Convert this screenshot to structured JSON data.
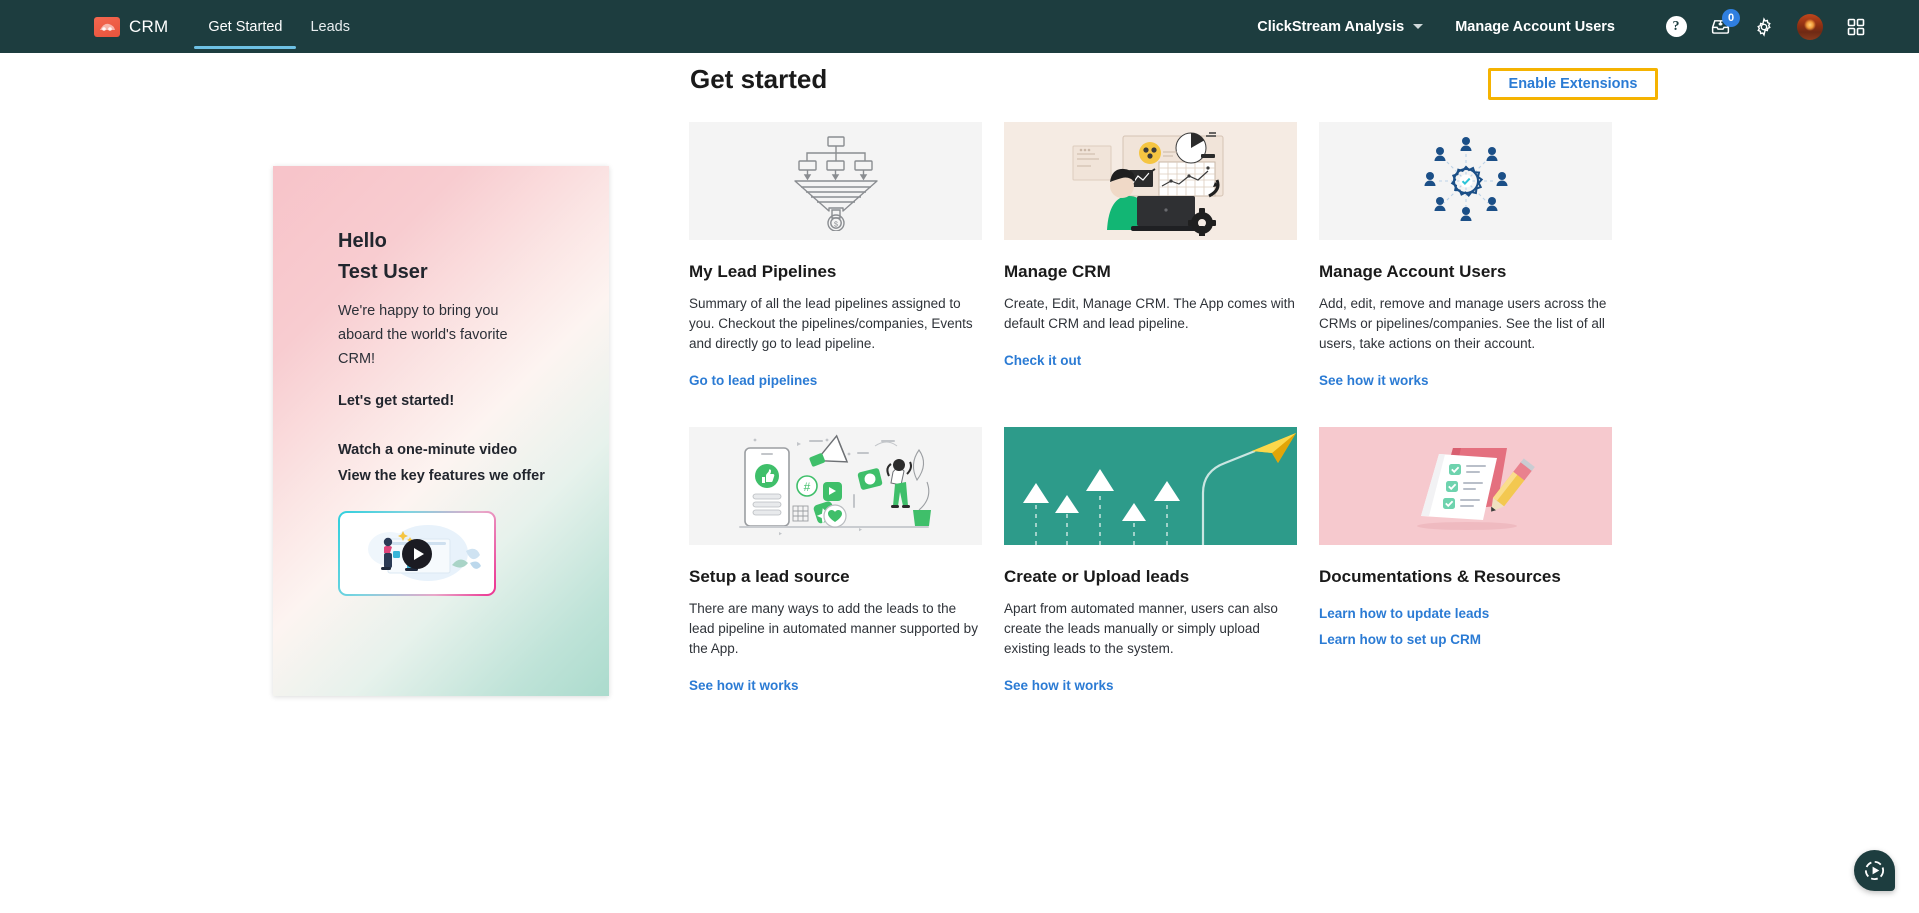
{
  "nav": {
    "logo_icon": "crm-logo-icon",
    "brand": "CRM",
    "tabs": [
      {
        "label": "Get Started",
        "active": true
      },
      {
        "label": "Leads",
        "active": false
      }
    ],
    "workspace_select": "ClickStream Analysis",
    "manage_account_users": "Manage Account Users",
    "help_glyph": "?",
    "inbox_badge": "0",
    "icons": [
      "help-icon",
      "inbox-icon",
      "gear-icon",
      "avatar",
      "app-grid-icon"
    ]
  },
  "header": {
    "title": "Get started",
    "enable_extensions": "Enable Extensions",
    "highlight_color": "#f5b301",
    "link_color": "#2b7bd4"
  },
  "welcome": {
    "hello": "Hello",
    "name": "Test User",
    "body": "We're happy to bring you aboard the world's favorite CRM!",
    "cta": "Let's get started!",
    "link_video": "Watch a one-minute video",
    "link_features": "View the key features we offer",
    "video_thumb_alt": "one-minute intro video thumbnail"
  },
  "cards": [
    {
      "title": "My Lead Pipelines",
      "desc": "Summary of all the lead pipelines assigned to you. Checkout the pipelines/companies, Events and directly go to lead pipeline.",
      "links": [
        "Go to lead pipelines"
      ],
      "img_bg": "#f4f4f4",
      "img_name": "funnel-pipeline-illustration"
    },
    {
      "title": "Manage CRM",
      "desc": "Create, Edit, Manage CRM. The App comes with default CRM and lead pipeline.",
      "links": [
        "Check it out"
      ],
      "img_bg": "#f5ebe3",
      "img_name": "person-at-laptop-dashboard-illustration"
    },
    {
      "title": "Manage Account Users",
      "desc": "Add, edit, remove and manage users across the CRMs or pipelines/companies. See the list of all users, take actions on their account.",
      "links": [
        "See how it works"
      ],
      "img_bg": "#f4f4f4",
      "img_name": "users-around-gear-illustration"
    },
    {
      "title": "Setup a lead source",
      "desc": "There are many ways to add the leads to the lead pipeline in automated manner supported by the App.",
      "links": [
        "See how it works"
      ],
      "img_bg": "#f4f4f4",
      "img_name": "social-media-phone-megaphone-illustration"
    },
    {
      "title": "Create or Upload leads",
      "desc": "Apart from automated manner, users can also create the leads manually or simply upload existing leads to the system.",
      "links": [
        "See how it works"
      ],
      "img_bg": "#2d9b8a",
      "img_name": "paper-plane-rising-arrows-illustration"
    },
    {
      "title": "Documentations & Resources",
      "desc": "",
      "links": [
        "Learn how to update leads",
        "Learn how to set up CRM"
      ],
      "img_bg": "#f6c9ce",
      "img_name": "checklist-notebook-pencil-illustration"
    }
  ],
  "fab": {
    "icon": "play-circle-icon"
  }
}
